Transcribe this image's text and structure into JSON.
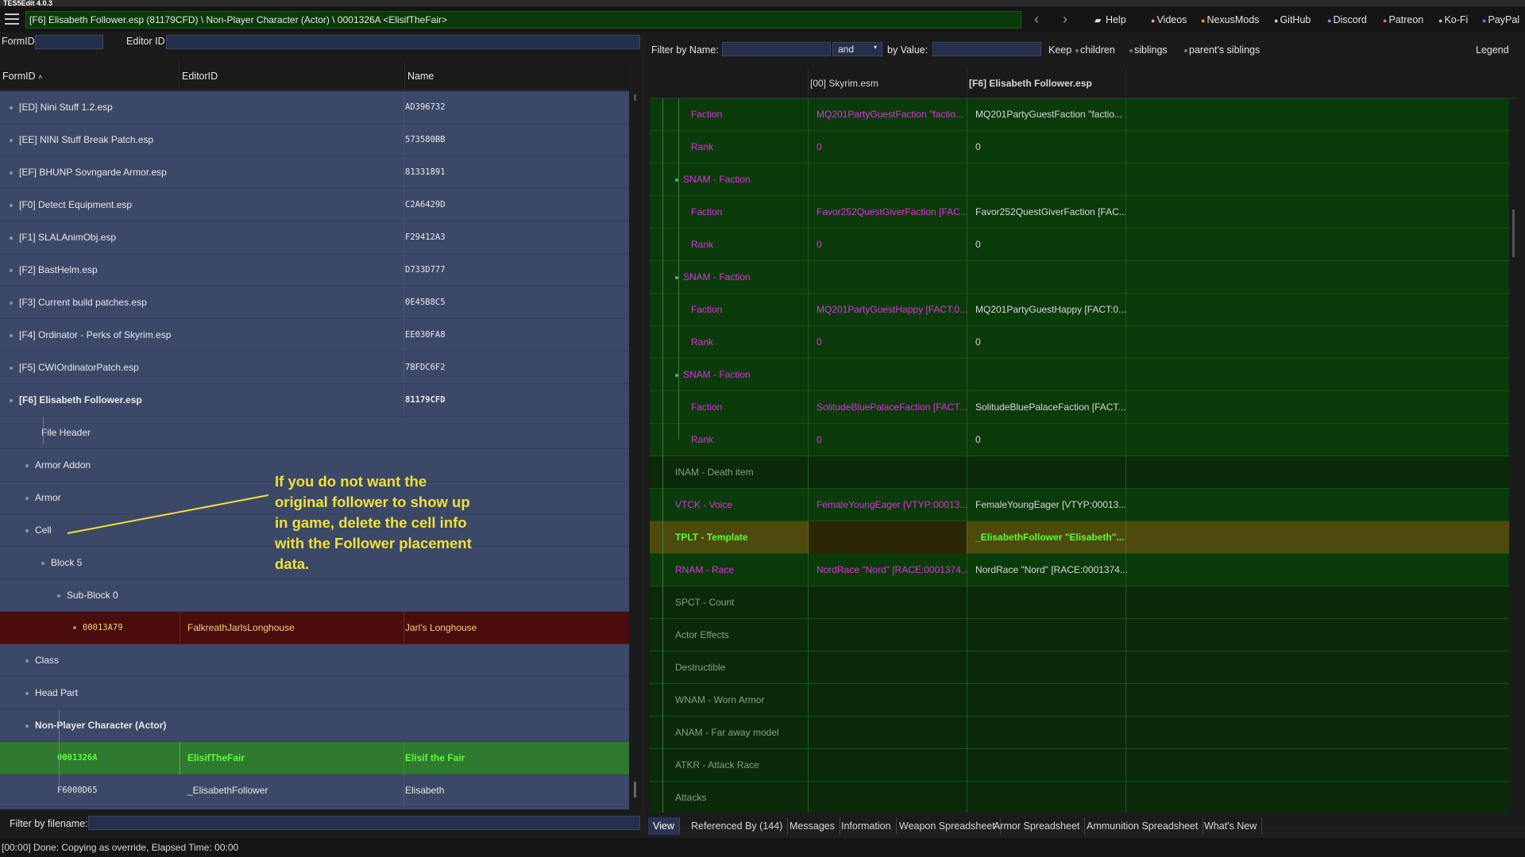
{
  "window": {
    "title": "TES5Edit 4.0.3"
  },
  "toolbar": {
    "path": "[F6] Elisabeth Follower.esp (81179CFD) \\ Non-Player Character (Actor) \\ 0001326A <ElisifTheFair>",
    "back": "‹",
    "forward": "›",
    "links": [
      {
        "label": "Help",
        "icon": "book-icon"
      },
      {
        "label": "Videos",
        "icon": "video-icon"
      },
      {
        "label": "NexusMods",
        "icon": "nexus-icon"
      },
      {
        "label": "GitHub",
        "icon": "github-icon"
      },
      {
        "label": "Discord",
        "icon": "discord-icon"
      },
      {
        "label": "Patreon",
        "icon": "patreon-icon"
      },
      {
        "label": "Ko-Fi",
        "icon": "kofi-icon"
      },
      {
        "label": "PayPal",
        "icon": "paypal-icon"
      }
    ]
  },
  "left": {
    "formid_label": "FormID",
    "formid_value": "",
    "editorid_label": "Editor ID",
    "editorid_value": "",
    "columns": [
      "FormID",
      "EditorID",
      "Name"
    ],
    "sort_indicator": "˄",
    "rows": [
      {
        "c1": "[ED] Nini Stuff 1.2.esp",
        "c2": "",
        "c3": "AD396732"
      },
      {
        "c1": "[EE] NINI Stuff Break Patch.esp",
        "c2": "",
        "c3": "573580BB"
      },
      {
        "c1": "[EF] BHUNP Sovngarde Armor.esp",
        "c2": "",
        "c3": "81331891"
      },
      {
        "c1": "[F0] Detect Equipment.esp",
        "c2": "",
        "c3": "C2A6429D"
      },
      {
        "c1": "[F1] SLALAnimObj.esp",
        "c2": "",
        "c3": "F29412A3"
      },
      {
        "c1": "[F2] BastHelm.esp",
        "c2": "",
        "c3": "D733D777"
      },
      {
        "c1": "[F3] Current build patches.esp",
        "c2": "",
        "c3": "0E45B8C5"
      },
      {
        "c1": "[F4] Ordinator - Perks of Skyrim.esp",
        "c2": "",
        "c3": "EE030FA8"
      },
      {
        "c1": "[F5] CWIOrdinatorPatch.esp",
        "c2": "",
        "c3": "7BFDC6F2"
      },
      {
        "c1": "[F6] Elisabeth Follower.esp",
        "c2": "",
        "c3": "81179CFD"
      },
      {
        "c1": "File Header",
        "c2": "",
        "c3": ""
      },
      {
        "c1": "Armor Addon",
        "c2": "",
        "c3": ""
      },
      {
        "c1": "Armor",
        "c2": "",
        "c3": ""
      },
      {
        "c1": "Cell",
        "c2": "",
        "c3": ""
      },
      {
        "c1": "Block 5",
        "c2": "",
        "c3": ""
      },
      {
        "c1": "Sub-Block 0",
        "c2": "",
        "c3": ""
      },
      {
        "c1": "00013A79",
        "c2": "FalkreathJarlsLonghouse",
        "c3": "Jarl's Longhouse"
      },
      {
        "c1": "Class",
        "c2": "",
        "c3": ""
      },
      {
        "c1": "Head Part",
        "c2": "",
        "c3": ""
      },
      {
        "c1": "Non-Player Character (Actor)",
        "c2": "",
        "c3": ""
      },
      {
        "c1": "0001326A",
        "c2": "ElisifTheFair",
        "c3": "Elisif the Fair"
      },
      {
        "c1": "F6000D65",
        "c2": "_ElisabethFollower",
        "c3": "Elisabeth"
      }
    ],
    "annotation": "If you do not want the original follower to show up in game, delete the cell info with the Follower placement data.",
    "filter_label": "Filter by filename:",
    "filter_value": ""
  },
  "right": {
    "filter_name_label": "Filter by Name:",
    "filter_name_value": "",
    "and_value": "and",
    "filter_value_label": "by Value:",
    "filter_value_value": "",
    "keep_label": "Keep",
    "keep_options": [
      "children",
      "siblings",
      "parent's siblings"
    ],
    "legend": "Legend",
    "col_master": "[00] Skyrim.esm",
    "col_plugin": "[F6] Elisabeth Follower.esp",
    "rows": [
      {
        "name": "Faction",
        "v1": "MQ201PartyGuestFaction \"factio...",
        "v2": "MQ201PartyGuestFaction \"factio..."
      },
      {
        "name": "Rank",
        "v1": "0",
        "v2": "0"
      },
      {
        "name": "SNAM - Faction",
        "v1": "",
        "v2": ""
      },
      {
        "name": "Faction",
        "v1": "Favor252QuestGiverFaction [FAC...",
        "v2": "Favor252QuestGiverFaction [FAC..."
      },
      {
        "name": "Rank",
        "v1": "0",
        "v2": "0"
      },
      {
        "name": "SNAM - Faction",
        "v1": "",
        "v2": ""
      },
      {
        "name": "Faction",
        "v1": "MQ201PartyGuestHappy [FACT:0...",
        "v2": "MQ201PartyGuestHappy [FACT:0..."
      },
      {
        "name": "Rank",
        "v1": "0",
        "v2": "0"
      },
      {
        "name": "SNAM - Faction",
        "v1": "",
        "v2": ""
      },
      {
        "name": "Faction",
        "v1": "SolitudeBluePalaceFaction [FACT...",
        "v2": "SolitudeBluePalaceFaction [FACT..."
      },
      {
        "name": "Rank",
        "v1": "0",
        "v2": "0"
      },
      {
        "name": "INAM - Death item",
        "v1": "",
        "v2": ""
      },
      {
        "name": "VTCK - Voice",
        "v1": "FemaleYoungEager [VTYP:00013...",
        "v2": "FemaleYoungEager [VTYP:00013..."
      },
      {
        "name": "TPLT - Template",
        "v1": "",
        "v2": "_ElisabethFollower \"Elisabeth\"..."
      },
      {
        "name": "RNAM - Race",
        "v1": "NordRace \"Nord\" [RACE:0001374...",
        "v2": "NordRace \"Nord\" [RACE:0001374..."
      },
      {
        "name": "SPCT - Count",
        "v1": "",
        "v2": ""
      },
      {
        "name": "Actor Effects",
        "v1": "",
        "v2": ""
      },
      {
        "name": "Destructible",
        "v1": "",
        "v2": ""
      },
      {
        "name": "WNAM - Worn Armor",
        "v1": "",
        "v2": ""
      },
      {
        "name": "ANAM - Far away model",
        "v1": "",
        "v2": ""
      },
      {
        "name": "ATKR - Attack Race",
        "v1": "",
        "v2": ""
      },
      {
        "name": "Attacks",
        "v1": "",
        "v2": ""
      }
    ],
    "tabs": [
      "View",
      "Referenced By (144)",
      "Messages",
      "Information",
      "Weapon Spreadsheet",
      "Armor Spreadsheet",
      "Ammunition Spreadsheet",
      "What's New"
    ]
  },
  "status": "[00:00] Done: Copying as override, Elapsed Time: 00:00",
  "colors": {
    "accent_green": "#5cff3a",
    "magenta": "#e030e0",
    "annotation": "#f1e236"
  }
}
